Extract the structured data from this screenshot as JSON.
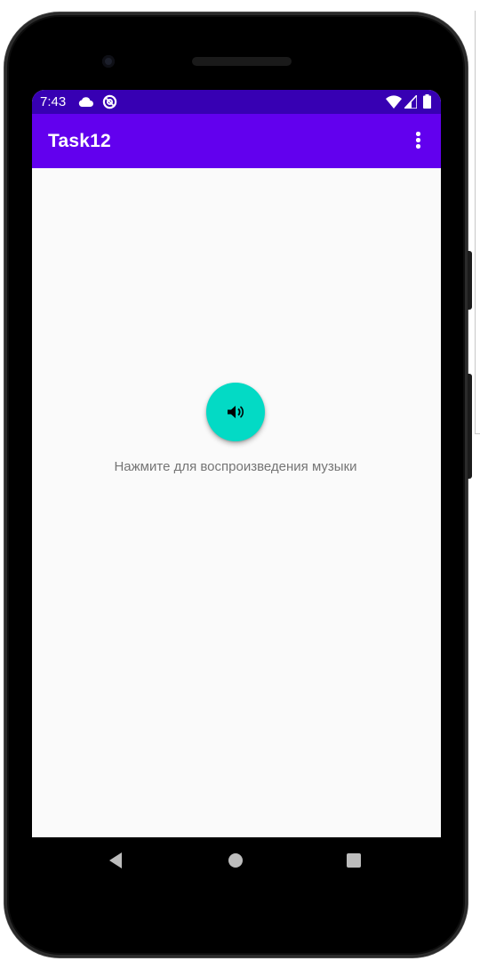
{
  "status_bar": {
    "time": "7:43",
    "left_icons": [
      "cloud-icon",
      "sync-icon"
    ],
    "right_icons": [
      "wifi-icon",
      "signal-icon",
      "battery-icon"
    ]
  },
  "app_bar": {
    "title": "Task12",
    "menu_icon": "more-vert-icon"
  },
  "main": {
    "play_button_icon": "volume-icon",
    "hint": "Нажмите для воспроизведения музыки"
  },
  "nav_bar": {
    "icons": [
      "back-icon",
      "home-icon",
      "recents-icon"
    ]
  },
  "colors": {
    "status_bar": "#3700b3",
    "app_bar": "#6200ee",
    "fab": "#03dac5",
    "screen_bg": "#fafafa",
    "hint_text": "#757575"
  }
}
